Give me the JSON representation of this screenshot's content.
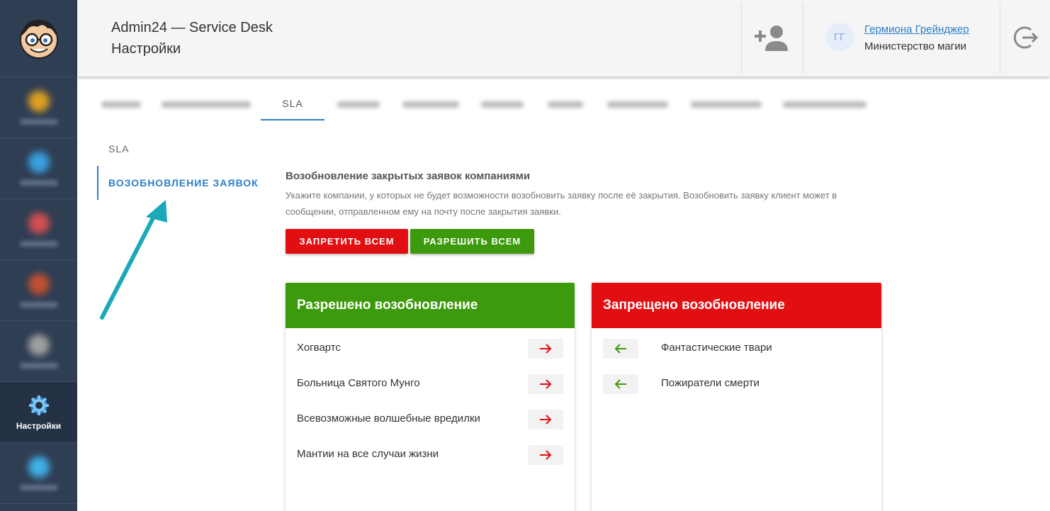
{
  "sidebar": {
    "items": [
      {
        "label": "",
        "color": "#e0a020"
      },
      {
        "label": "",
        "color": "#3aa0e0"
      },
      {
        "label": "",
        "color": "#d05050"
      },
      {
        "label": "",
        "color": "#c05030"
      },
      {
        "label": "",
        "color": "#a0a0a0"
      },
      {
        "label": "Настройки",
        "icon": "gear-icon",
        "active": true
      },
      {
        "label": "",
        "color": "#40b0e8"
      }
    ]
  },
  "header": {
    "title": "Admin24 — Service Desk",
    "subtitle": "Настройки",
    "user": {
      "initials": "ГГ",
      "name": "Гермиона Грейнджер",
      "organization": "Министерство магии"
    }
  },
  "tabs": {
    "active_label": "SLA"
  },
  "sidemenu": {
    "items": [
      {
        "label": "SLA",
        "active": false
      },
      {
        "label": "ВОЗОБНОВЛЕНИЕ ЗАЯВОК",
        "active": true
      }
    ]
  },
  "content": {
    "title": "Возобновление закрытых заявок компаниями",
    "description": "Укажите компании, у которых не будет возможности возобновить заявку после её закрытия. Возобновить заявку клиент может в сообщении, отправленном ему на почту после закрытия заявки.",
    "buttons": {
      "deny_all": "ЗАПРЕТИТЬ ВСЕМ",
      "allow_all": "РАЗРЕШИТЬ ВСЕМ"
    },
    "allowed": {
      "title": "Разрешено возобновление",
      "items": [
        "Хогвартс",
        "Больница Святого Мунго",
        "Всевозможные волшебные вредилки",
        "Мантии на все случаи жизни"
      ]
    },
    "denied": {
      "title": "Запрещено возобновление",
      "items": [
        "Фантастические твари",
        "Пожиратели смерти"
      ]
    }
  },
  "colors": {
    "accent": "#2a7ec8",
    "allow": "#3c9a0c",
    "deny": "#e20f12",
    "sidebar": "#2f3e53",
    "annotation_arrow": "#1ba8b8"
  }
}
